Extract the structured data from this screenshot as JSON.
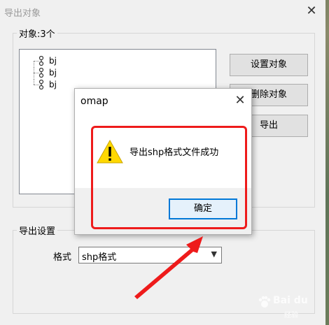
{
  "window": {
    "title": "导出对象",
    "close_glyph": "✕"
  },
  "objects_group": {
    "legend": "对象:3个",
    "tree_items": [
      {
        "label": "bj"
      },
      {
        "label": "bj"
      },
      {
        "label": "bj"
      }
    ],
    "buttons": {
      "set_objects": "设置对象",
      "delete_objects": "删除对象",
      "export": "导出"
    }
  },
  "export_settings": {
    "legend": "导出设置",
    "format_label": "格式",
    "format_value": "shp格式"
  },
  "message_box": {
    "title": "omap",
    "close_glyph": "✕",
    "icon": "warning-icon",
    "icon_glyph": "!",
    "text": "导出shp格式文件成功",
    "ok_label": "确定"
  },
  "watermark": {
    "text": "Bai du",
    "subtext": "经验"
  },
  "colors": {
    "annotation_red": "#ee1b1b",
    "dialog_bg": "#f0f0f0",
    "ok_border": "#0078d7",
    "warning_yellow": "#ffd800"
  }
}
